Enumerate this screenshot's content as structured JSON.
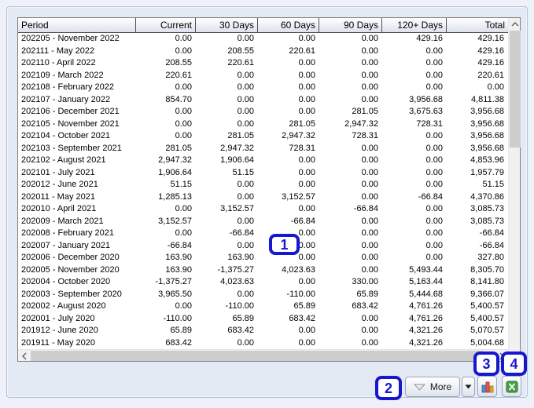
{
  "table": {
    "columns": [
      "Period",
      "Current",
      "30 Days",
      "60 Days",
      "90 Days",
      "120+ Days",
      "Total"
    ],
    "rows": [
      [
        "202205 - November 2022",
        "0.00",
        "0.00",
        "0.00",
        "0.00",
        "429.16",
        "429.16"
      ],
      [
        "202111 - May 2022",
        "0.00",
        "208.55",
        "220.61",
        "0.00",
        "0.00",
        "429.16"
      ],
      [
        "202110 - April 2022",
        "208.55",
        "220.61",
        "0.00",
        "0.00",
        "0.00",
        "429.16"
      ],
      [
        "202109 - March 2022",
        "220.61",
        "0.00",
        "0.00",
        "0.00",
        "0.00",
        "220.61"
      ],
      [
        "202108 - February 2022",
        "0.00",
        "0.00",
        "0.00",
        "0.00",
        "0.00",
        "0.00"
      ],
      [
        "202107 - January 2022",
        "854.70",
        "0.00",
        "0.00",
        "0.00",
        "3,956.68",
        "4,811.38"
      ],
      [
        "202106 - December 2021",
        "0.00",
        "0.00",
        "0.00",
        "281.05",
        "3,675.63",
        "3,956.68"
      ],
      [
        "202105 - November 2021",
        "0.00",
        "0.00",
        "281.05",
        "2,947.32",
        "728.31",
        "3,956.68"
      ],
      [
        "202104 - October 2021",
        "0.00",
        "281.05",
        "2,947.32",
        "728.31",
        "0.00",
        "3,956.68"
      ],
      [
        "202103 - September 2021",
        "281.05",
        "2,947.32",
        "728.31",
        "0.00",
        "0.00",
        "3,956.68"
      ],
      [
        "202102 - August 2021",
        "2,947.32",
        "1,906.64",
        "0.00",
        "0.00",
        "0.00",
        "4,853.96"
      ],
      [
        "202101 - July 2021",
        "1,906.64",
        "51.15",
        "0.00",
        "0.00",
        "0.00",
        "1,957.79"
      ],
      [
        "202012 - June 2021",
        "51.15",
        "0.00",
        "0.00",
        "0.00",
        "0.00",
        "51.15"
      ],
      [
        "202011 - May 2021",
        "1,285.13",
        "0.00",
        "3,152.57",
        "0.00",
        "-66.84",
        "4,370.86"
      ],
      [
        "202010 - April 2021",
        "0.00",
        "3,152.57",
        "0.00",
        "-66.84",
        "0.00",
        "3,085.73"
      ],
      [
        "202009 - March 2021",
        "3,152.57",
        "0.00",
        "-66.84",
        "0.00",
        "0.00",
        "3,085.73"
      ],
      [
        "202008 - February 2021",
        "0.00",
        "-66.84",
        "0.00",
        "0.00",
        "0.00",
        "-66.84"
      ],
      [
        "202007 - January 2021",
        "-66.84",
        "0.00",
        "0.00",
        "0.00",
        "0.00",
        "-66.84"
      ],
      [
        "202006 - December 2020",
        "163.90",
        "163.90",
        "0.00",
        "0.00",
        "0.00",
        "327.80"
      ],
      [
        "202005 - November 2020",
        "163.90",
        "-1,375.27",
        "4,023.63",
        "0.00",
        "5,493.44",
        "8,305.70"
      ],
      [
        "202004 - October 2020",
        "-1,375.27",
        "4,023.63",
        "0.00",
        "330.00",
        "5,163.44",
        "8,141.80"
      ],
      [
        "202003 - September 2020",
        "3,965.50",
        "0.00",
        "-110.00",
        "65.89",
        "5,444.68",
        "9,366.07"
      ],
      [
        "202002 - August 2020",
        "0.00",
        "-110.00",
        "65.89",
        "683.42",
        "4,761.26",
        "5,400.57"
      ],
      [
        "202001 - July 2020",
        "-110.00",
        "65.89",
        "683.42",
        "0.00",
        "4,761.26",
        "5,400.57"
      ],
      [
        "201912 - June 2020",
        "65.89",
        "683.42",
        "0.00",
        "0.00",
        "4,321.26",
        "5,070.57"
      ],
      [
        "201911 - May 2020",
        "683.42",
        "0.00",
        "0.00",
        "0.00",
        "4,321.26",
        "5,004.68"
      ]
    ]
  },
  "footer": {
    "more_label": "More"
  },
  "icons": {
    "more_button": "triangle-down-outline",
    "more_dropdown": "triangle-down-solid",
    "chart_button": "bar-chart",
    "excel_button": "excel-export",
    "scrollbar": "chevron-arrows"
  },
  "annotations": [
    {
      "label": "1"
    },
    {
      "label": "2"
    },
    {
      "label": "3"
    },
    {
      "label": "4"
    }
  ],
  "colors": {
    "annotation_blue": "#1717cf",
    "excel_green": "#43a047",
    "chart_bar_blue": "#5b8dd9",
    "chart_bar_red": "#e2574c",
    "chart_bar_orange": "#e8a33d"
  }
}
